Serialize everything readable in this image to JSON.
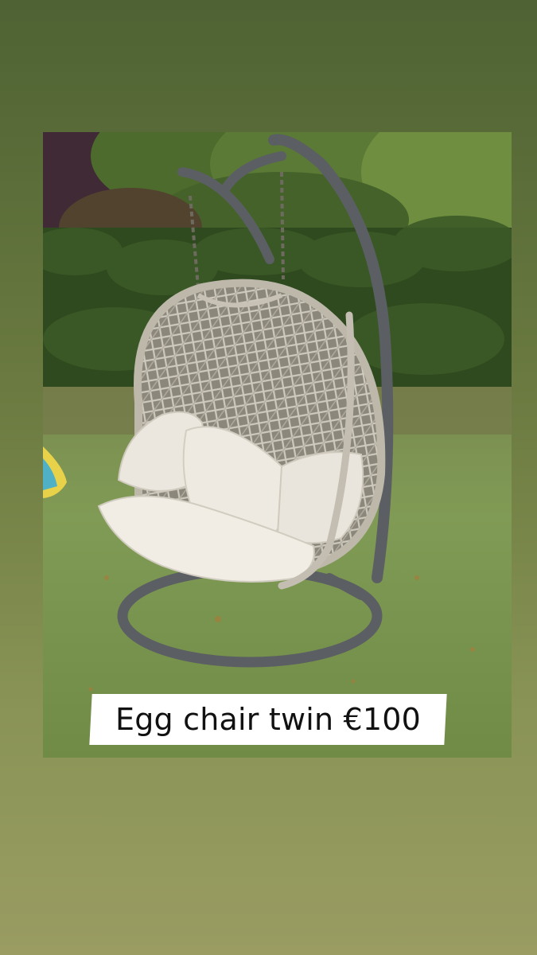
{
  "post": {
    "caption": "Egg chair twin €100"
  },
  "colors": {
    "background_top": "#4e6233",
    "background_bottom": "#9a9c62",
    "caption_bg": "#ffffff",
    "caption_text": "#111111"
  },
  "photo": {
    "subject": "hanging-egg-chair",
    "cushion_color": "#ece8df",
    "frame_color": "#5b5f63",
    "wicker_color": "#b9b4a6"
  }
}
